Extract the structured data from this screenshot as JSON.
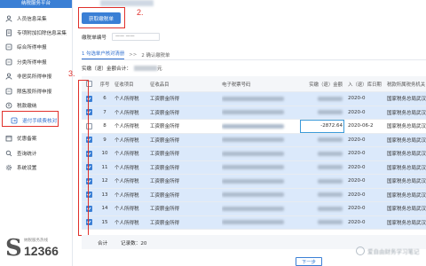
{
  "sidebar": {
    "brand": "纳税服务平台",
    "items": [
      {
        "label": "人员信息采集",
        "icon": "person-icon"
      },
      {
        "label": "专项附加扣除信息采集",
        "icon": "document-icon"
      },
      {
        "label": "综合所得申报",
        "icon": "file-icon"
      },
      {
        "label": "分类所得申报",
        "icon": "file-icon"
      },
      {
        "label": "非居民所得申报",
        "icon": "person-icon"
      },
      {
        "label": "限售股所得申报",
        "icon": "file-icon"
      },
      {
        "label": "税款缴纳",
        "icon": "circle-icon"
      },
      {
        "label": "退付手续费核对",
        "icon": "refund-icon"
      },
      {
        "label": "优惠备案",
        "icon": "calendar-icon"
      },
      {
        "label": "查询统计",
        "icon": "search-icon"
      },
      {
        "label": "系统设置",
        "icon": "gear-icon"
      }
    ],
    "logo_tag": "纳税服务热线",
    "logo_num": "12366"
  },
  "toolbar": {
    "get_button": "获取缴税单"
  },
  "annotations": {
    "step2": "2.",
    "step3": "3."
  },
  "form": {
    "label": "缴税单编号",
    "select_value": "—— ——"
  },
  "steps": {
    "step1": "1 勾选单户核对清册",
    "arrow": ">>",
    "step2": "2 确认缴税单"
  },
  "summary": {
    "label": "实缴（退）金额合计：",
    "suffix": "元"
  },
  "table": {
    "headers": [
      "序号",
      "征收项目",
      "征收品目",
      "电子税票号码",
      "实缴（退）金额",
      "入（退）库日期",
      "税款所属税务机关"
    ],
    "rows": [
      {
        "checked": true,
        "no": "6",
        "tax": "个人所得税",
        "item": "工资薪金所得",
        "amount": "",
        "date": "2020-0",
        "org": "国家税务总局武汉"
      },
      {
        "checked": true,
        "no": "7",
        "tax": "个人所得税",
        "item": "工资薪金所得",
        "amount": "",
        "date": "2020-0",
        "org": "国家税务总局武汉"
      },
      {
        "checked": false,
        "no": "8",
        "tax": "个人所得税",
        "item": "工资薪金所得",
        "amount": "-2872.64",
        "date": "2020-06-2",
        "org": "国家税务总局武汉"
      },
      {
        "checked": true,
        "no": "9",
        "tax": "个人所得税",
        "item": "工资薪金所得",
        "amount": "",
        "date": "2020-0",
        "org": "国家税务总局武汉"
      },
      {
        "checked": true,
        "no": "10",
        "tax": "个人所得税",
        "item": "工资薪金所得",
        "amount": "",
        "date": "2020-0",
        "org": "国家税务总局武汉"
      },
      {
        "checked": true,
        "no": "11",
        "tax": "个人所得税",
        "item": "工资薪金所得",
        "amount": "",
        "date": "2020-0",
        "org": "国家税务总局武汉"
      },
      {
        "checked": true,
        "no": "12",
        "tax": "个人所得税",
        "item": "工资薪金所得",
        "amount": "",
        "date": "2020-0",
        "org": "国家税务总局武汉"
      },
      {
        "checked": true,
        "no": "13",
        "tax": "个人所得税",
        "item": "工资薪金所得",
        "amount": "",
        "date": "2020-0",
        "org": "国家税务总局武汉"
      },
      {
        "checked": true,
        "no": "14",
        "tax": "个人所得税",
        "item": "工资薪金所得",
        "amount": "",
        "date": "2020-0",
        "org": "国家税务总局武汉"
      },
      {
        "checked": true,
        "no": "15",
        "tax": "个人所得税",
        "item": "工资薪金所得",
        "amount": "",
        "date": "2020-0",
        "org": "国家税务总局武汉"
      }
    ],
    "footer": {
      "label": "合计",
      "count": "记录数：20"
    }
  },
  "next_button": "下一步",
  "watermark": "爱自由财务学习笔记",
  "colors": {
    "accent": "#3a7fd5",
    "annotation": "#e0312c",
    "selected_row": "#dbe9fb"
  }
}
